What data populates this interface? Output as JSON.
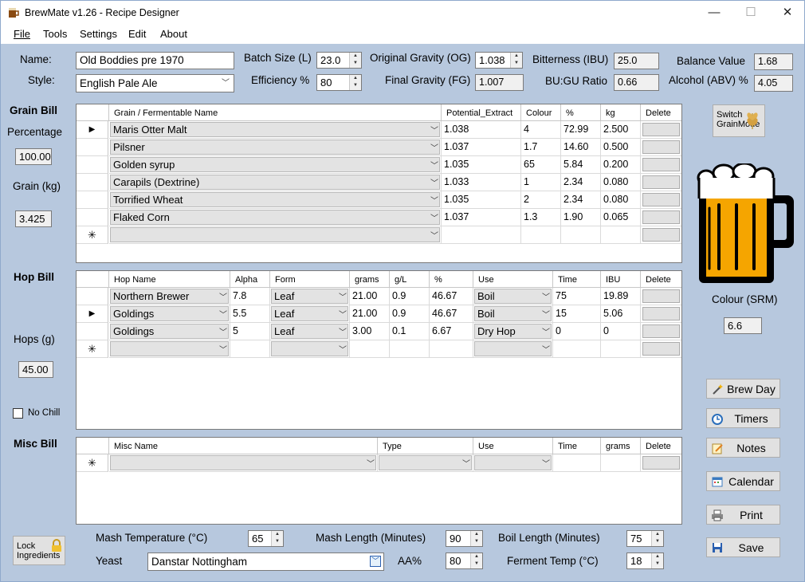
{
  "window": {
    "title": "BrewMate v1.26 - Recipe Designer",
    "minimize_glyph": "—",
    "maximize_glyph": "☐",
    "close_glyph": "✕"
  },
  "menu": [
    "File",
    "Tools",
    "Settings",
    "Edit",
    "About"
  ],
  "recipe": {
    "name_label": "Name:",
    "name": "Old Boddies pre 1970",
    "style_label": "Style:",
    "style": "English Pale Ale",
    "batch_label": "Batch Size (L)",
    "batch": "23.0",
    "eff_label": "Efficiency %",
    "eff": "80",
    "og_label": "Original Gravity (OG)",
    "og": "1.038",
    "fg_label": "Final Gravity (FG)",
    "fg": "1.007",
    "ibu_label": "Bitterness (IBU)",
    "ibu": "25.0",
    "bugu_label": "BU:GU Ratio",
    "bugu": "0.66",
    "balance_label": "Balance Value",
    "balance": "1.68",
    "abv_label": "Alcohol (ABV) %",
    "abv": "4.05"
  },
  "grain": {
    "section_label": "Grain Bill",
    "pct_label": "Percentage",
    "pct": "100.00",
    "kg_label": "Grain (kg)",
    "kg": "3.425",
    "headers": [
      "Grain / Fermentable Name",
      "Potential_Extract",
      "Colour",
      "%",
      "kg",
      "Delete"
    ],
    "rows": [
      {
        "name": "Maris Otter Malt",
        "extract": "1.038",
        "colour": "4",
        "pct": "72.99",
        "kg": "2.500"
      },
      {
        "name": "Pilsner",
        "extract": "1.037",
        "colour": "1.7",
        "pct": "14.60",
        "kg": "0.500"
      },
      {
        "name": "Golden syrup",
        "extract": "1.035",
        "colour": "65",
        "pct": "5.84",
        "kg": "0.200"
      },
      {
        "name": "Carapils (Dextrine)",
        "extract": "1.033",
        "colour": "1",
        "pct": "2.34",
        "kg": "0.080"
      },
      {
        "name": "Torrified Wheat",
        "extract": "1.035",
        "colour": "2",
        "pct": "2.34",
        "kg": "0.080"
      },
      {
        "name": "Flaked Corn",
        "extract": "1.037",
        "colour": "1.3",
        "pct": "1.90",
        "kg": "0.065"
      }
    ]
  },
  "hops": {
    "section_label": "Hop Bill",
    "hops_label": "Hops (g)",
    "hops": "45.00",
    "nochill_label": "No Chill",
    "nochill_checked": false,
    "headers": [
      "Hop Name",
      "Alpha",
      "Form",
      "grams",
      "g/L",
      "%",
      "Use",
      "Time",
      "IBU",
      "Delete"
    ],
    "rows": [
      {
        "name": "Northern Brewer",
        "alpha": "7.8",
        "form": "Leaf",
        "grams": "21.00",
        "gl": "0.9",
        "pct": "46.67",
        "use": "Boil",
        "time": "75",
        "ibu": "19.89"
      },
      {
        "name": "Goldings",
        "alpha": "5.5",
        "form": "Leaf",
        "grams": "21.00",
        "gl": "0.9",
        "pct": "46.67",
        "use": "Boil",
        "time": "15",
        "ibu": "5.06"
      },
      {
        "name": "Goldings",
        "alpha": "5",
        "form": "Leaf",
        "grams": "3.00",
        "gl": "0.1",
        "pct": "6.67",
        "use": "Dry Hop",
        "time": "0",
        "ibu": "0"
      }
    ]
  },
  "misc": {
    "section_label": "Misc Bill",
    "headers": [
      "Misc Name",
      "Type",
      "Use",
      "Time",
      "grams",
      "Delete"
    ]
  },
  "side": {
    "switch_label_1": "Switch",
    "switch_label_2": "GrainMode",
    "colour_label": "Colour (SRM)",
    "colour": "6.6",
    "beer_color": "#f5a500",
    "buttons": {
      "brewday": "Brew Day",
      "timers": "Timers",
      "notes": "Notes",
      "calendar": "Calendar",
      "print": "Print",
      "save": "Save"
    }
  },
  "bottom": {
    "lock_label_1": "Lock",
    "lock_label_2": "Ingredients",
    "mash_temp_label": "Mash Temperature (°C)",
    "mash_temp": "65",
    "mash_len_label": "Mash Length (Minutes)",
    "mash_len": "90",
    "boil_len_label": "Boil Length (Minutes)",
    "boil_len": "75",
    "yeast_label": "Yeast",
    "yeast": "Danstar Nottingham",
    "aa_label": "AA%",
    "aa": "80",
    "ferment_label": "Ferment Temp (°C)",
    "ferment": "18"
  },
  "grid_glyphs": {
    "current_row": "▶",
    "new_row": "✳",
    "dropdown": "﹀"
  }
}
